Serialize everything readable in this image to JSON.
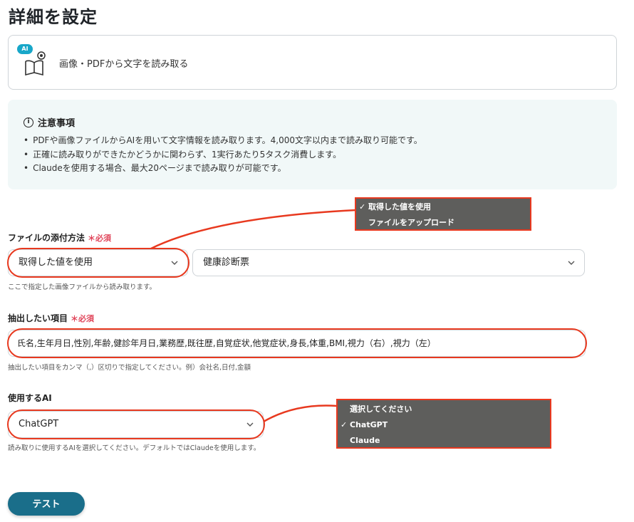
{
  "page": {
    "title": "詳細を設定"
  },
  "action": {
    "badge": "AI",
    "icon": "book-eye-icon",
    "label": "画像・PDFから文字を読み取る"
  },
  "notice": {
    "title": "注意事項",
    "items": [
      "PDFや画像ファイルからAIを用いて文字情報を読み取ります。4,000文字以内まで読み取り可能です。",
      "正確に読み取りができたかどうかに関わらず、1実行あたり5タスク消費します。",
      "Claudeを使用する場合、最大20ページまで読み取りが可能です。"
    ]
  },
  "file_field": {
    "label": "ファイルの添付方法",
    "required": "必須",
    "method_value": "取得した値を使用",
    "source_value": "健康診断票",
    "hint": "ここで指定した画像ファイルから読み取ります。",
    "dropdown_options": [
      {
        "label": "取得した値を使用",
        "checked": true
      },
      {
        "label": "ファイルをアップロード",
        "checked": false
      }
    ]
  },
  "extract_field": {
    "label": "抽出したい項目",
    "required": "必須",
    "value": "氏名,生年月日,性別,年齢,健診年月日,業務歴,既往歴,自覚症状,他覚症状,身長,体重,BMI,視力（右）,視力（左）",
    "hint": "抽出したい項目をカンマ（,）区切りで指定してください。例）会社名,日付,金額"
  },
  "ai_field": {
    "label": "使用するAI",
    "value": "ChatGPT",
    "hint": "読み取りに使用するAIを選択してください。デフォルトではClaudeを使用します。",
    "dropdown_options": [
      {
        "label": "選択してください",
        "checked": false
      },
      {
        "label": "ChatGPT",
        "checked": true
      },
      {
        "label": "Claude",
        "checked": false
      }
    ]
  },
  "buttons": {
    "test": "テスト"
  },
  "colors": {
    "highlight": "#e8391f",
    "accent": "#1a6e8a",
    "badge": "#18a7c9",
    "required": "#e0455a"
  }
}
